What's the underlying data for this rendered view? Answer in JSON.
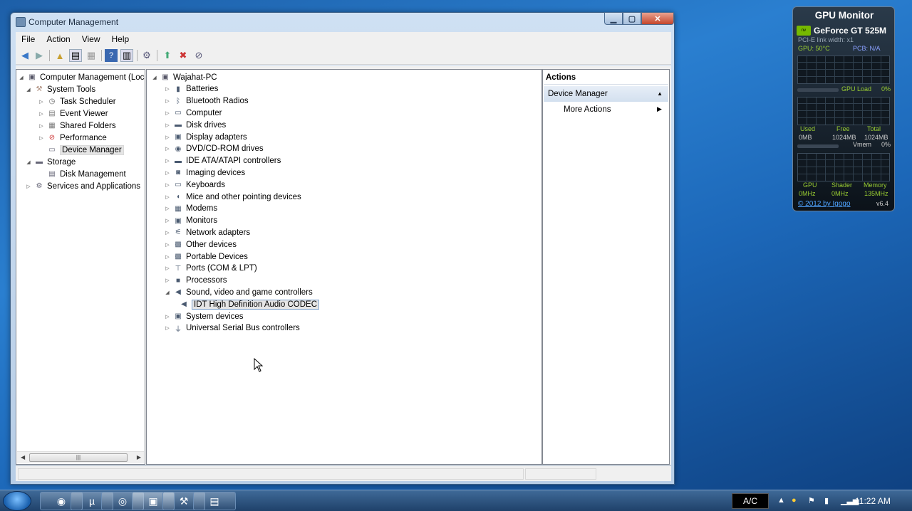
{
  "window": {
    "title": "Computer Management"
  },
  "menu": [
    "File",
    "Action",
    "View",
    "Help"
  ],
  "left_tree": [
    {
      "label": "Computer Management (Local",
      "level": 0,
      "arrow": "◢",
      "icon": "computer-management-icon"
    },
    {
      "label": "System Tools",
      "level": 1,
      "arrow": "◢",
      "icon": "tools-icon"
    },
    {
      "label": "Task Scheduler",
      "level": 2,
      "arrow": "▷",
      "icon": "clock-icon"
    },
    {
      "label": "Event Viewer",
      "level": 2,
      "arrow": "▷",
      "icon": "event-viewer-icon"
    },
    {
      "label": "Shared Folders",
      "level": 2,
      "arrow": "▷",
      "icon": "shared-folders-icon"
    },
    {
      "label": "Performance",
      "level": 2,
      "arrow": "▷",
      "icon": "performance-icon"
    },
    {
      "label": "Device Manager",
      "level": 2,
      "arrow": "",
      "icon": "device-manager-icon",
      "selected": true
    },
    {
      "label": "Storage",
      "level": 1,
      "arrow": "◢",
      "icon": "storage-icon"
    },
    {
      "label": "Disk Management",
      "level": 2,
      "arrow": "",
      "icon": "disk-management-icon"
    },
    {
      "label": "Services and Applications",
      "level": 1,
      "arrow": "▷",
      "icon": "services-icon"
    }
  ],
  "device_tree": {
    "root": "Wajahat-PC",
    "items": [
      {
        "label": "Batteries",
        "icon": "battery-icon",
        "glyph": "▮"
      },
      {
        "label": "Bluetooth Radios",
        "icon": "bluetooth-icon",
        "glyph": "ᛒ"
      },
      {
        "label": "Computer",
        "icon": "computer-icon",
        "glyph": "▭"
      },
      {
        "label": "Disk drives",
        "icon": "disk-drive-icon",
        "glyph": "▬"
      },
      {
        "label": "Display adapters",
        "icon": "display-adapter-icon",
        "glyph": "▣"
      },
      {
        "label": "DVD/CD-ROM drives",
        "icon": "dvd-icon",
        "glyph": "◉"
      },
      {
        "label": "IDE ATA/ATAPI controllers",
        "icon": "ide-controller-icon",
        "glyph": "▬"
      },
      {
        "label": "Imaging devices",
        "icon": "camera-icon",
        "glyph": "◙"
      },
      {
        "label": "Keyboards",
        "icon": "keyboard-icon",
        "glyph": "▭"
      },
      {
        "label": "Mice and other pointing devices",
        "icon": "mouse-icon",
        "glyph": "◖"
      },
      {
        "label": "Modems",
        "icon": "modem-icon",
        "glyph": "▦"
      },
      {
        "label": "Monitors",
        "icon": "monitor-icon",
        "glyph": "▣"
      },
      {
        "label": "Network adapters",
        "icon": "network-icon",
        "glyph": "⚟"
      },
      {
        "label": "Other devices",
        "icon": "other-devices-icon",
        "glyph": "▩"
      },
      {
        "label": "Portable Devices",
        "icon": "portable-device-icon",
        "glyph": "▩"
      },
      {
        "label": "Ports (COM & LPT)",
        "icon": "port-icon",
        "glyph": "⊤"
      },
      {
        "label": "Processors",
        "icon": "processor-icon",
        "glyph": "■"
      },
      {
        "label": "Sound, video and game controllers",
        "icon": "speaker-icon",
        "glyph": "◀",
        "expanded": true,
        "children": [
          {
            "label": "IDT High Definition Audio CODEC",
            "icon": "audio-device-icon",
            "glyph": "◀"
          }
        ]
      },
      {
        "label": "System devices",
        "icon": "system-devices-icon",
        "glyph": "▣"
      },
      {
        "label": "Universal Serial Bus controllers",
        "icon": "usb-icon",
        "glyph": "⏚"
      }
    ]
  },
  "actions": {
    "header": "Actions",
    "section": "Device Manager",
    "more": "More Actions"
  },
  "gpu": {
    "title": "GPU Monitor",
    "model": "GeForce GT 525M",
    "pcie": "PCI-E link width: x1",
    "gpu_temp": "GPU: 50°C",
    "pcb_temp": "PCB: N/A",
    "gpu_load_label": "GPU Load",
    "gpu_load": "0%",
    "used_label": "Used",
    "free_label": "Free",
    "total_label": "Total",
    "used": "0MB",
    "free": "1024MB",
    "total": "1024MB",
    "vmem_label": "Vmem",
    "vmem": "0%",
    "gpu_clk_label": "GPU",
    "shader_label": "Shader",
    "memory_label": "Memory",
    "gpu_clk": "0MHz",
    "shader_clk": "0MHz",
    "memory_clk": "135MHz",
    "copyright": "© 2012 by Igogo",
    "version": "v6.4"
  },
  "taskbar": {
    "tray_label": "A/C",
    "clock": "11:22 AM"
  },
  "colors": {
    "desktop": "#1d5fa8",
    "selection": "#e5e5e5",
    "nvidia_green": "#76b900"
  }
}
